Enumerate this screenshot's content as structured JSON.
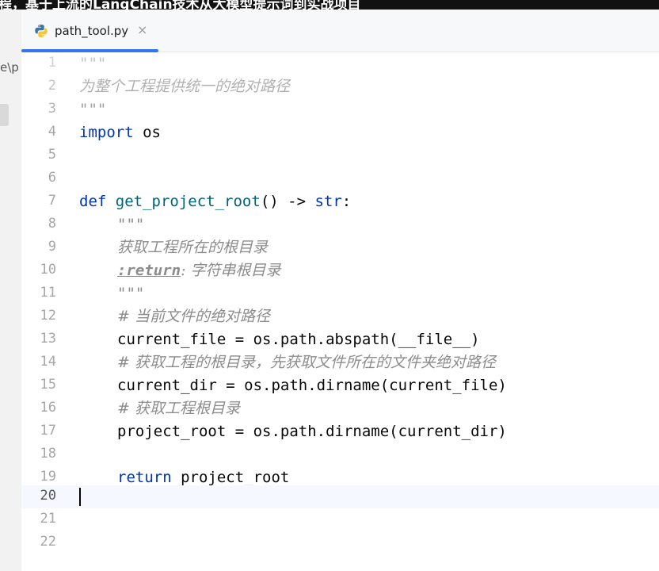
{
  "window": {
    "title_fragment": "程，基于上流的LangChain技术从大模型提示词到实战项目"
  },
  "left_panel": {
    "path_fragment": "e\\p"
  },
  "tab": {
    "label": "path_tool.py",
    "close": "×"
  },
  "editor": {
    "current_line": 20,
    "lines": [
      {
        "n": "1"
      },
      {
        "n": "2"
      },
      {
        "n": "3"
      },
      {
        "n": "4"
      },
      {
        "n": "5"
      },
      {
        "n": "6"
      },
      {
        "n": "7"
      },
      {
        "n": "8"
      },
      {
        "n": "9"
      },
      {
        "n": "10"
      },
      {
        "n": "11"
      },
      {
        "n": "12"
      },
      {
        "n": "13"
      },
      {
        "n": "14"
      },
      {
        "n": "15"
      },
      {
        "n": "16"
      },
      {
        "n": "17"
      },
      {
        "n": "18"
      },
      {
        "n": "19"
      },
      {
        "n": "20"
      },
      {
        "n": "21"
      },
      {
        "n": "22"
      }
    ],
    "tokens": {
      "l1": "\"\"\"",
      "l2": "为整个工程提供统一的绝对路径",
      "l3": "\"\"\"",
      "l4_kw": "import",
      "l4_rest": " os",
      "l7_kw": "def",
      "l7_fn": "get_project_root",
      "l7_rest": "() -> ",
      "l7_type": "str",
      "l7_colon": ":",
      "l8": "\"\"\"",
      "l9": "获取工程所在的根目录",
      "l10_tag": ":return",
      "l10_rest": ": 字符串根目录",
      "l11": "\"\"\"",
      "l12": "# 当前文件的绝对路径",
      "l13": "current_file = os.path.abspath(__file__)",
      "l14": "# 获取工程的根目录，先获取文件所在的文件夹绝对路径",
      "l15": "current_dir = os.path.dirname(current_file)",
      "l16": "# 获取工程根目录",
      "l17": "project_root = os.path.dirname(current_dir)",
      "l19_kw": "return",
      "l19_rest": " project_root"
    }
  },
  "colors": {
    "keyword": "#0033b3",
    "function": "#00627a",
    "comment": "#8c8c8c",
    "tab_underline": "#3574f0"
  },
  "icons": {
    "tab_icon": "python-file-icon"
  }
}
